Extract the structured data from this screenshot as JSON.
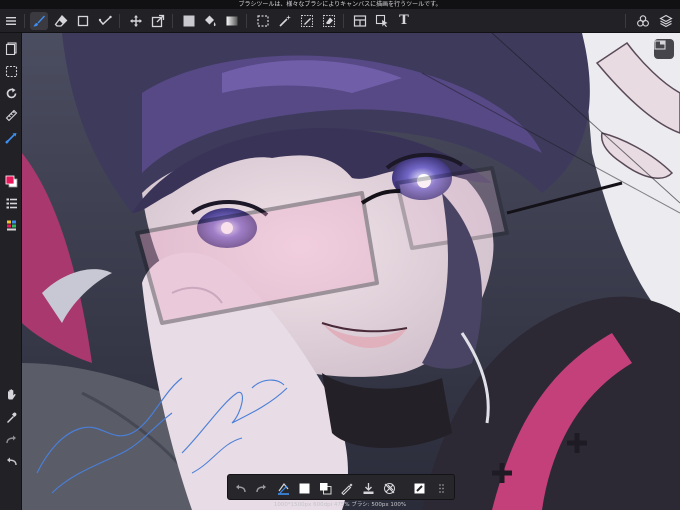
{
  "hint_text": "ブラシツールは、様々なブラシによりキャンバスに描画を行うツールです。",
  "status_text": "1000*1500px 600dpi 475% ブラシ: 500px 100%",
  "colors": {
    "toolbar_bg": "#222226",
    "icon": "#d6d6da",
    "accent_blue": "#3d8ff0",
    "foreground_color": "#e8185a",
    "signature_blue": "#4a7fd8"
  },
  "top_toolbar": {
    "icons": [
      "menu-icon",
      "brush-icon",
      "eraser-icon",
      "shape-icon",
      "correction-icon",
      "move-icon",
      "transform-icon",
      "fill-color-icon",
      "bucket-icon",
      "gradient-icon",
      "select-rect-icon",
      "magic-wand-icon",
      "select-pen-icon",
      "select-eraser-icon",
      "frame-divider-icon",
      "select-move-icon",
      "text-icon",
      "materials-icon",
      "layers-icon"
    ],
    "text_tool_glyph": "T"
  },
  "left_sidebar": {
    "icons": [
      "pages-icon",
      "select-icon",
      "rotate-icon",
      "ruler-icon",
      "snap-icon",
      "color-swatch-icon",
      "brush-list-icon",
      "palette-icon",
      "hand-icon",
      "eyedropper-icon",
      "redo-icon",
      "undo-icon"
    ]
  },
  "bottom_toolbar": {
    "icons": [
      "undo-icon",
      "redo-icon",
      "fill-layer-icon",
      "white-color-icon",
      "swap-colors-icon",
      "pen-icon",
      "download-icon",
      "snap-off-icon",
      "clear-icon",
      "grid-icon"
    ]
  }
}
